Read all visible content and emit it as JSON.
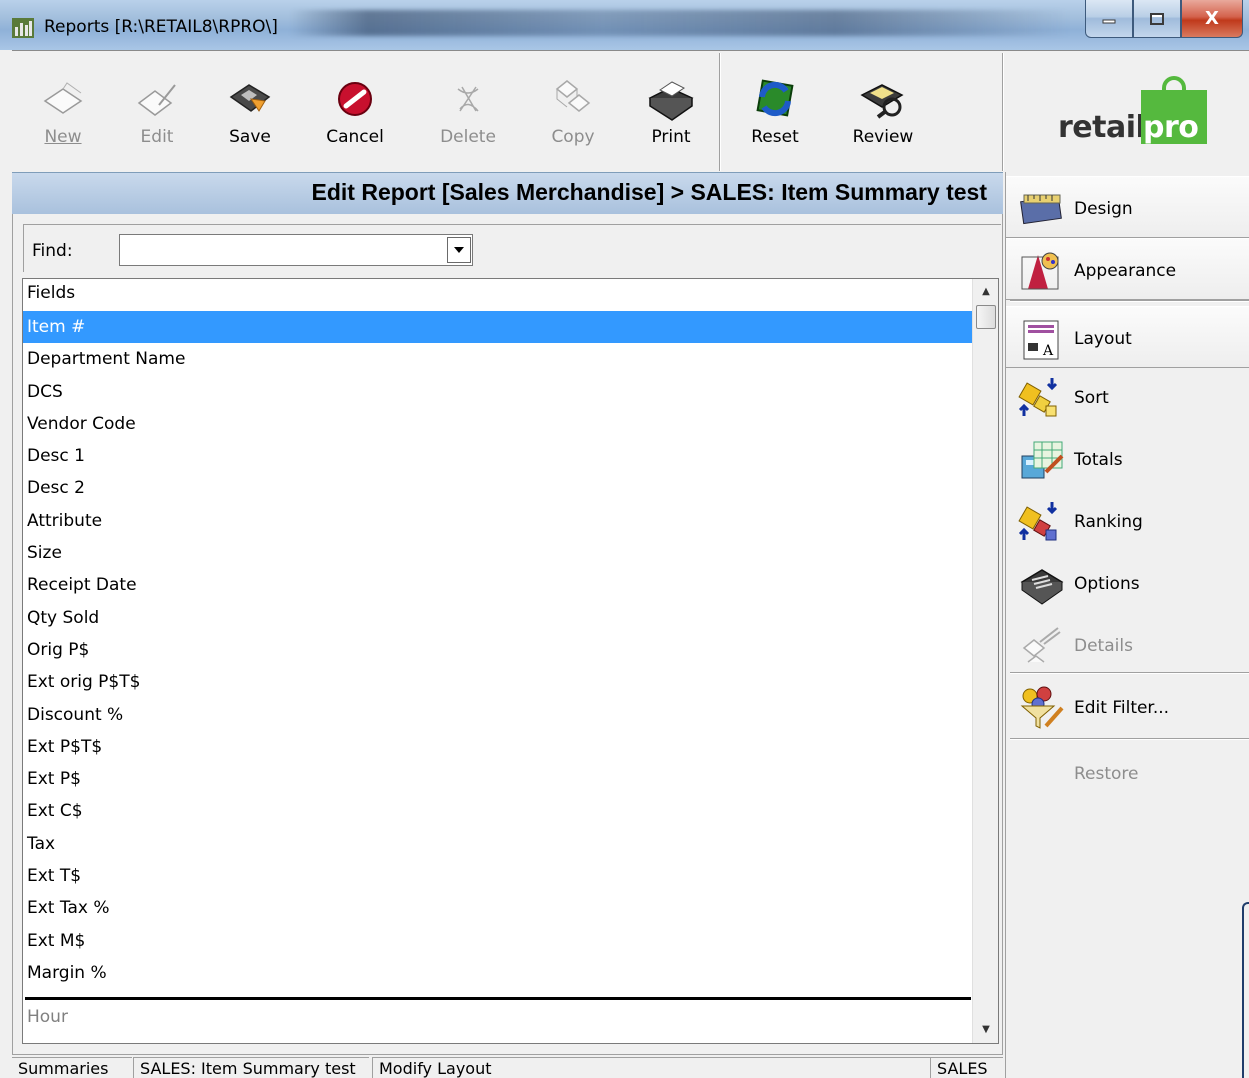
{
  "window": {
    "title": "Reports [R:\\RETAIL8\\RPRO\\]",
    "close_glyph": "X"
  },
  "toolbar": {
    "buttons": [
      {
        "label": "New",
        "accel": "N",
        "enabled": false,
        "icon": "new-icon"
      },
      {
        "label": "Edit",
        "accel": "E",
        "enabled": false,
        "icon": "edit-icon"
      },
      {
        "label": "Save",
        "accel": "S",
        "enabled": true,
        "icon": "save-icon"
      },
      {
        "label": "Cancel",
        "accel": "a",
        "enabled": true,
        "icon": "cancel-icon"
      },
      {
        "label": "Delete",
        "accel": "D",
        "enabled": false,
        "icon": "delete-icon"
      },
      {
        "label": "Copy",
        "accel": "C",
        "enabled": false,
        "icon": "copy-icon"
      },
      {
        "label": "Print",
        "accel": "P",
        "enabled": true,
        "icon": "print-icon"
      },
      {
        "label": "Reset",
        "accel": "t",
        "enabled": true,
        "icon": "reset-icon"
      },
      {
        "label": "Review",
        "accel": "R",
        "enabled": true,
        "icon": "review-icon"
      }
    ]
  },
  "logo": {
    "part1": "retail",
    "part2": "pro",
    "brand_color": "#55b93e"
  },
  "header": {
    "title": "Edit Report [Sales Merchandise] > SALES: Item Summary test"
  },
  "find": {
    "label": "Find:",
    "value": ""
  },
  "fields": {
    "column_header": "Fields",
    "rows": [
      "Item #",
      "Department Name",
      "DCS",
      "Vendor Code",
      "Desc 1",
      "Desc 2",
      "Attribute",
      "Size",
      "Receipt Date",
      "Qty Sold",
      "Orig P$",
      "Ext orig P$T$",
      "Discount %",
      "Ext P$T$",
      "Ext P$",
      "Ext C$",
      "Tax",
      "Ext T$",
      "Ext Tax %",
      "Ext M$",
      "Margin %"
    ],
    "selected_index": 0,
    "available": "Hour"
  },
  "status": {
    "p1": "Summaries",
    "p2": "SALES: Item Summary test",
    "p3": "Modify Layout",
    "p4": "SALES"
  },
  "nav": {
    "design": "Design",
    "appearance": "Appearance",
    "layout": "Layout",
    "sort": "Sort",
    "totals": "Totals",
    "ranking": "Ranking",
    "options": "Options",
    "details": "Details",
    "edit_filter": "Edit Filter...",
    "restore": "Restore"
  },
  "colors": {
    "selection": "#3399ff",
    "header_band": "#a9c1dd"
  }
}
